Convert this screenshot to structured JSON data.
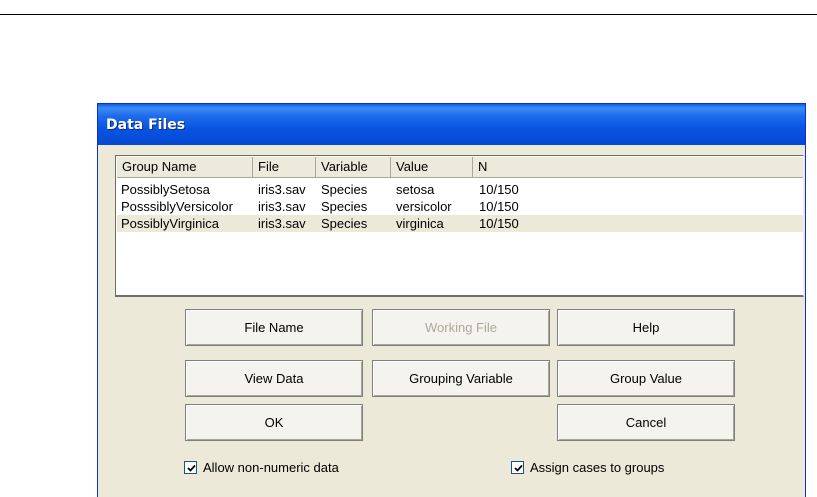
{
  "window": {
    "title": "Data Files"
  },
  "list": {
    "columns": [
      "Group Name",
      "File",
      "Variable",
      "Value",
      "N"
    ],
    "rows": [
      {
        "group": "PossiblySetosa",
        "file": "iris3.sav",
        "variable": "Species",
        "value": "setosa",
        "n": "10/150",
        "selected": false
      },
      {
        "group": "PosssiblyVersicolor",
        "file": "iris3.sav",
        "variable": "Species",
        "value": "versicolor",
        "n": "10/150",
        "selected": false
      },
      {
        "group": "PossiblyVirginica",
        "file": "iris3.sav",
        "variable": "Species",
        "value": "virginica",
        "n": "10/150",
        "selected": true
      }
    ]
  },
  "buttons": {
    "file_name": "File Name",
    "working_file": "Working File",
    "help": "Help",
    "view_data": "View Data",
    "grouping_variable": "Grouping Variable",
    "group_value": "Group Value",
    "ok": "OK",
    "cancel": "Cancel"
  },
  "options": {
    "allow_non_numeric": {
      "label": "Allow non-numeric data",
      "checked": true
    },
    "assign_cases": {
      "label": "Assign cases to groups",
      "checked": true
    }
  },
  "colors": {
    "title_bar": "#0854e3",
    "dialog_bg": "#ece9d8",
    "selected_row": "#ece9d8"
  }
}
